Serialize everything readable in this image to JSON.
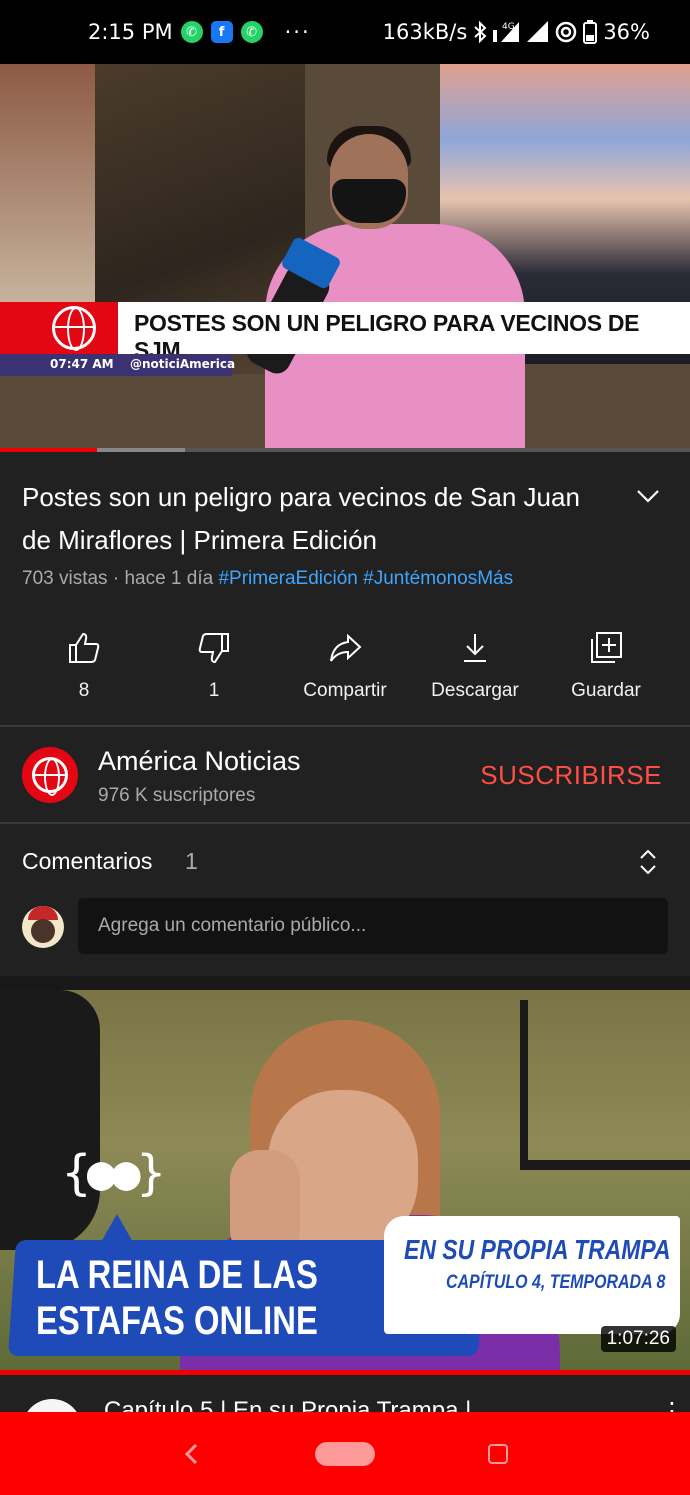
{
  "status_bar": {
    "time": "2:15 PM",
    "dots": "···",
    "net_speed": "163kB/s",
    "network_type": "4G",
    "battery": "36%",
    "icons": [
      "whatsapp-icon",
      "facebook-icon",
      "whatsapp-business-icon",
      "bluetooth-icon",
      "signal-icon",
      "hotspot-icon",
      "battery-icon"
    ]
  },
  "player": {
    "lower_third_headline": "POSTES SON UN PELIGRO PARA VECINOS DE SJM",
    "lower_third_time": "07:47 AM",
    "lower_third_handle": "@noticiAmerica",
    "progress": 0.14
  },
  "video": {
    "title": "Postes son un peligro para vecinos de San Juan de Miraflores | Primera Edición",
    "views": "703 vistas",
    "age": "hace 1 día",
    "tags": [
      "#PrimeraEdición",
      "#JuntémonosMás"
    ]
  },
  "actions": [
    {
      "label": "8",
      "icon": "thumbs-up-icon"
    },
    {
      "label": "1",
      "icon": "thumbs-down-icon"
    },
    {
      "label": "Compartir",
      "icon": "share-icon"
    },
    {
      "label": "Descargar",
      "icon": "download-icon"
    },
    {
      "label": "Guardar",
      "icon": "save-playlist-icon"
    }
  ],
  "channel": {
    "name": "América Noticias",
    "subscribers": "976 K suscriptores",
    "subscribe_label": "SUSCRIBIRSE"
  },
  "comments": {
    "title": "Comentarios",
    "count": "1",
    "placeholder": "Agrega un comentario público..."
  },
  "next_video": {
    "thumb_logo": "{●●}",
    "banner_line1": "LA REINA DE LAS",
    "banner_line2": "ESTAFAS ONLINE",
    "show_title": "EN SU PROPIA TRAMPA",
    "show_subtitle": "CAPÍTULO 4, TEMPORADA 8",
    "duration": "1:07:26",
    "title": "Capítulo 5 | En su Propia Trampa |"
  },
  "colors": {
    "background": "#212121",
    "accent_red": "#ff0000",
    "subscribe": "#ff4e45",
    "link": "#3ea6ff"
  }
}
